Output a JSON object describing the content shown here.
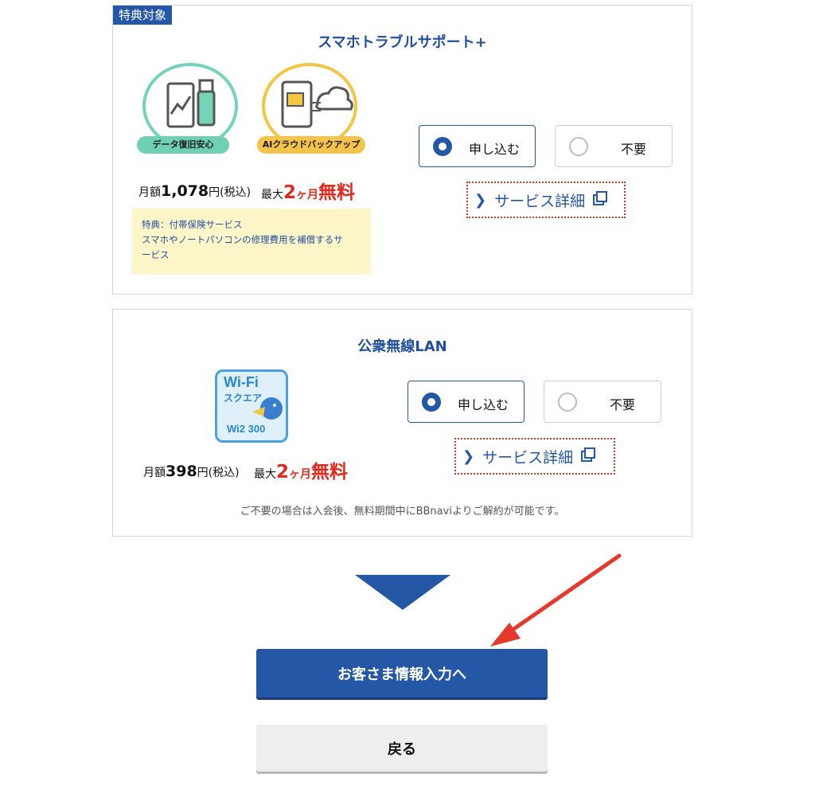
{
  "card1": {
    "tag": "特典対象",
    "title": "スマホトラブルサポート+",
    "icon1_label": "データ復旧安心",
    "icon2_label": "AIクラウドバックアップ",
    "price_prefix": "月額",
    "price_value": "1,078",
    "price_suffix": "円(税込)",
    "free_prefix": "最大",
    "free_num": "2",
    "free_unit": "ヶ月",
    "free_word": "無料",
    "benefit_line1": "特典：付帯保険サービス",
    "benefit_line2": "スマホやノートパソコンの修理費用を補償するサ",
    "benefit_line3": "ービス",
    "option_apply": "申し込む",
    "option_none": "不要",
    "detail_link": "サービス詳細",
    "selected": "apply"
  },
  "card2": {
    "title": "公衆無線LAN",
    "logo_line1": "Wi-Fi",
    "logo_line2": "スクエア",
    "logo_line3": "Wi2 300",
    "price_prefix": "月額",
    "price_value": "398",
    "price_suffix": "円(税込)",
    "free_prefix": "最大",
    "free_num": "2",
    "free_unit": "ヶ月",
    "free_word": "無料",
    "option_apply": "申し込む",
    "option_none": "不要",
    "detail_link": "サービス詳細",
    "note": "ご不要の場合は入会後、無料期間中にBBnaviよりご解約が可能です。",
    "selected": "apply"
  },
  "actions": {
    "next_label": "お客さま情報入力へ",
    "back_label": "戻る"
  },
  "colors": {
    "brand_blue": "#2457a6",
    "highlight_red": "#e4281b",
    "benefit_bg": "#fdf6c8"
  }
}
